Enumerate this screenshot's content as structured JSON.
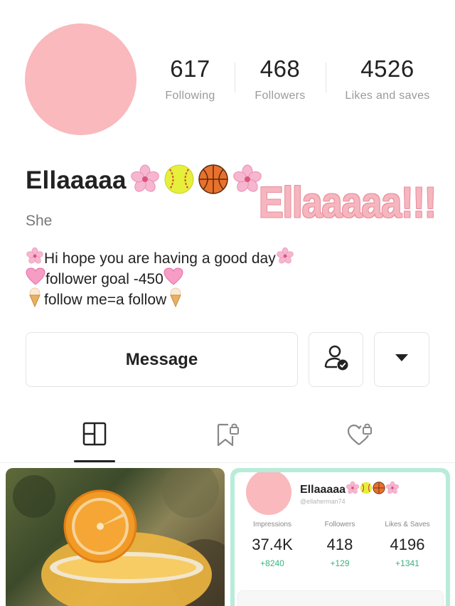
{
  "profile": {
    "stats": [
      {
        "value": "617",
        "label": "Following"
      },
      {
        "value": "468",
        "label": "Followers"
      },
      {
        "value": "4526",
        "label": "Likes and saves"
      }
    ],
    "name": "Ellaaaaa",
    "name_emojis": [
      "cherry-blossom",
      "softball",
      "basketball",
      "cherry-blossom"
    ],
    "sticker_text": "Ellaaaaa!!!",
    "pronoun": "She",
    "bio": [
      "Hi hope you are having a good day",
      "follower goal -450",
      "follow me=a follow"
    ],
    "avatar_color": "#f9b9bd"
  },
  "actions": {
    "message_label": "Message"
  },
  "card": {
    "name": "Ellaaaaa",
    "handle": "@ellaherman74",
    "columns": [
      {
        "label": "Impressions",
        "value": "37.4K",
        "delta": "+8240"
      },
      {
        "label": "Followers",
        "value": "418",
        "delta": "+129"
      },
      {
        "label": "Likes & Saves",
        "value": "4196",
        "delta": "+1341"
      }
    ],
    "border_color": "#b8ecd9",
    "delta_color": "#3ab27c"
  }
}
